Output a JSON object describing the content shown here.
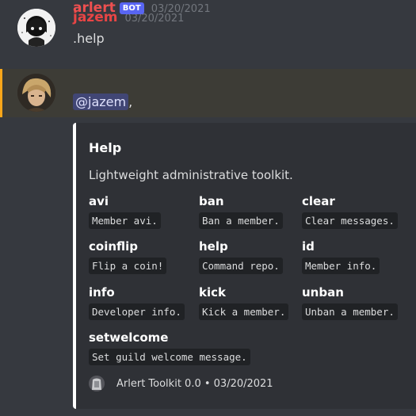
{
  "messages": [
    {
      "author": "jazem",
      "timestamp": "03/20/2021",
      "content": ".help"
    },
    {
      "author": "arlert",
      "bot_tag": "BOT",
      "timestamp": "03/20/2021",
      "mention": "@jazem",
      "trailing": ","
    }
  ],
  "embed": {
    "title": "Help",
    "description": "Lightweight administrative toolkit.",
    "fields": [
      {
        "name": "avi",
        "value": "Member avi."
      },
      {
        "name": "ban",
        "value": "Ban a member."
      },
      {
        "name": "clear",
        "value": "Clear messages."
      },
      {
        "name": "coinflip",
        "value": "Flip a coin!"
      },
      {
        "name": "help",
        "value": "Command repo."
      },
      {
        "name": "id",
        "value": "Member info."
      },
      {
        "name": "info",
        "value": "Developer info."
      },
      {
        "name": "kick",
        "value": "Kick a member."
      },
      {
        "name": "unban",
        "value": "Unban a member."
      },
      {
        "name": "setwelcome",
        "value": "Set guild welcome message."
      }
    ],
    "footer": "Arlert Toolkit 0.0 • 03/20/2021"
  },
  "colors": {
    "background": "#36393f",
    "highlight": "#3d3c36",
    "highlight_bar": "#faa61a",
    "embed_bg": "#2f3136",
    "embed_border": "#ffffff",
    "author_name": "#e84545",
    "bot_tag": "#5865f2",
    "mention_bg": "#414675"
  }
}
